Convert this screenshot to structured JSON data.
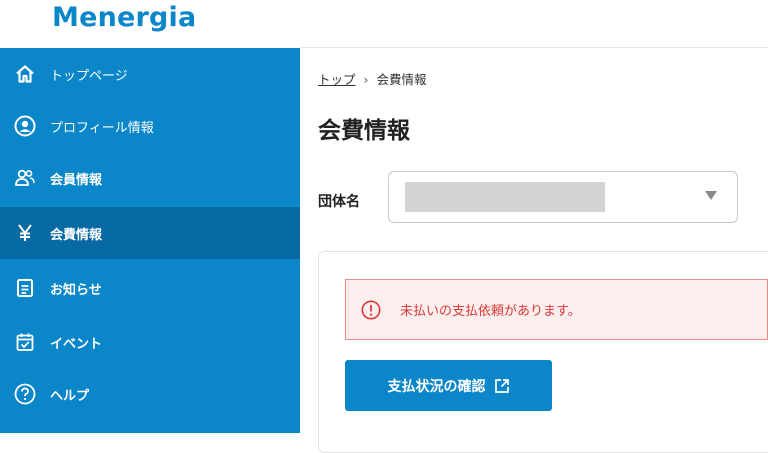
{
  "brand": {
    "name": "Menergia",
    "color": "#0a86c9"
  },
  "sidebar": {
    "items": [
      {
        "label": "トップページ",
        "icon": "home-icon"
      },
      {
        "label": "プロフィール情報",
        "icon": "profile-icon"
      },
      {
        "label": "会員情報",
        "icon": "members-icon"
      },
      {
        "label": "会費情報",
        "icon": "yen-icon",
        "active": true
      },
      {
        "label": "お知らせ",
        "icon": "notice-icon"
      },
      {
        "label": "イベント",
        "icon": "calendar-check-icon"
      },
      {
        "label": "ヘルプ",
        "icon": "help-icon"
      }
    ]
  },
  "breadcrumb": {
    "home": "トップ",
    "separator": "›",
    "current": "会費情報"
  },
  "page": {
    "title": "会費情報"
  },
  "org": {
    "label": "団体名",
    "selected_value": ""
  },
  "alert": {
    "text": "未払いの支払依頼があります。",
    "color": "#d93a3a"
  },
  "button": {
    "label": "支払状況の確認",
    "icon": "external-link-icon"
  }
}
